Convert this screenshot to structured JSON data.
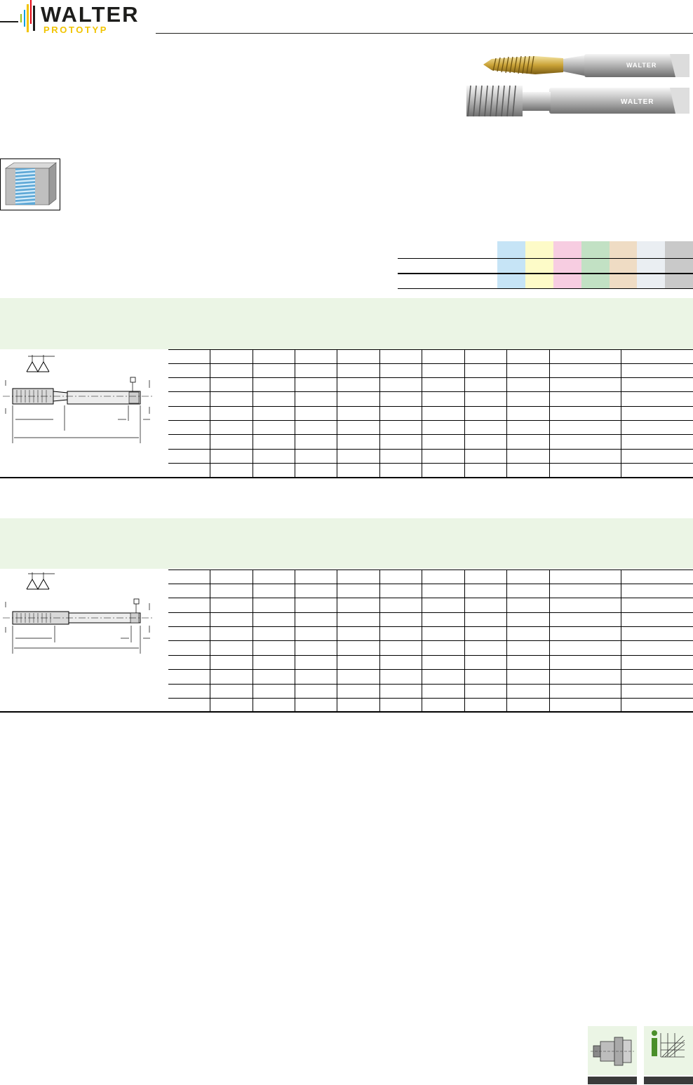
{
  "brand": {
    "name": "WALTER",
    "sub": "PROTOTYP",
    "colors": [
      "#e30613",
      "#f1c400",
      "#009fe3",
      "#95c11f",
      "#1d1d1b"
    ]
  },
  "icons": {
    "thread_hole": "internal-thread-hole-icon",
    "footer": [
      "tool-holder-icon",
      "info-diagram-icon"
    ]
  },
  "material_colors": [
    "#c6e4f6",
    "#fdfbc8",
    "#f7cde1",
    "#c2e1c4",
    "#efdcc4",
    "#eaeef2",
    "#c9c9c9"
  ],
  "section_band_color": "#ebf5e5",
  "sections": [
    {
      "id": "section-1",
      "rows": 8,
      "columns": 12
    },
    {
      "id": "section-2",
      "rows": 10,
      "columns": 12
    }
  ]
}
